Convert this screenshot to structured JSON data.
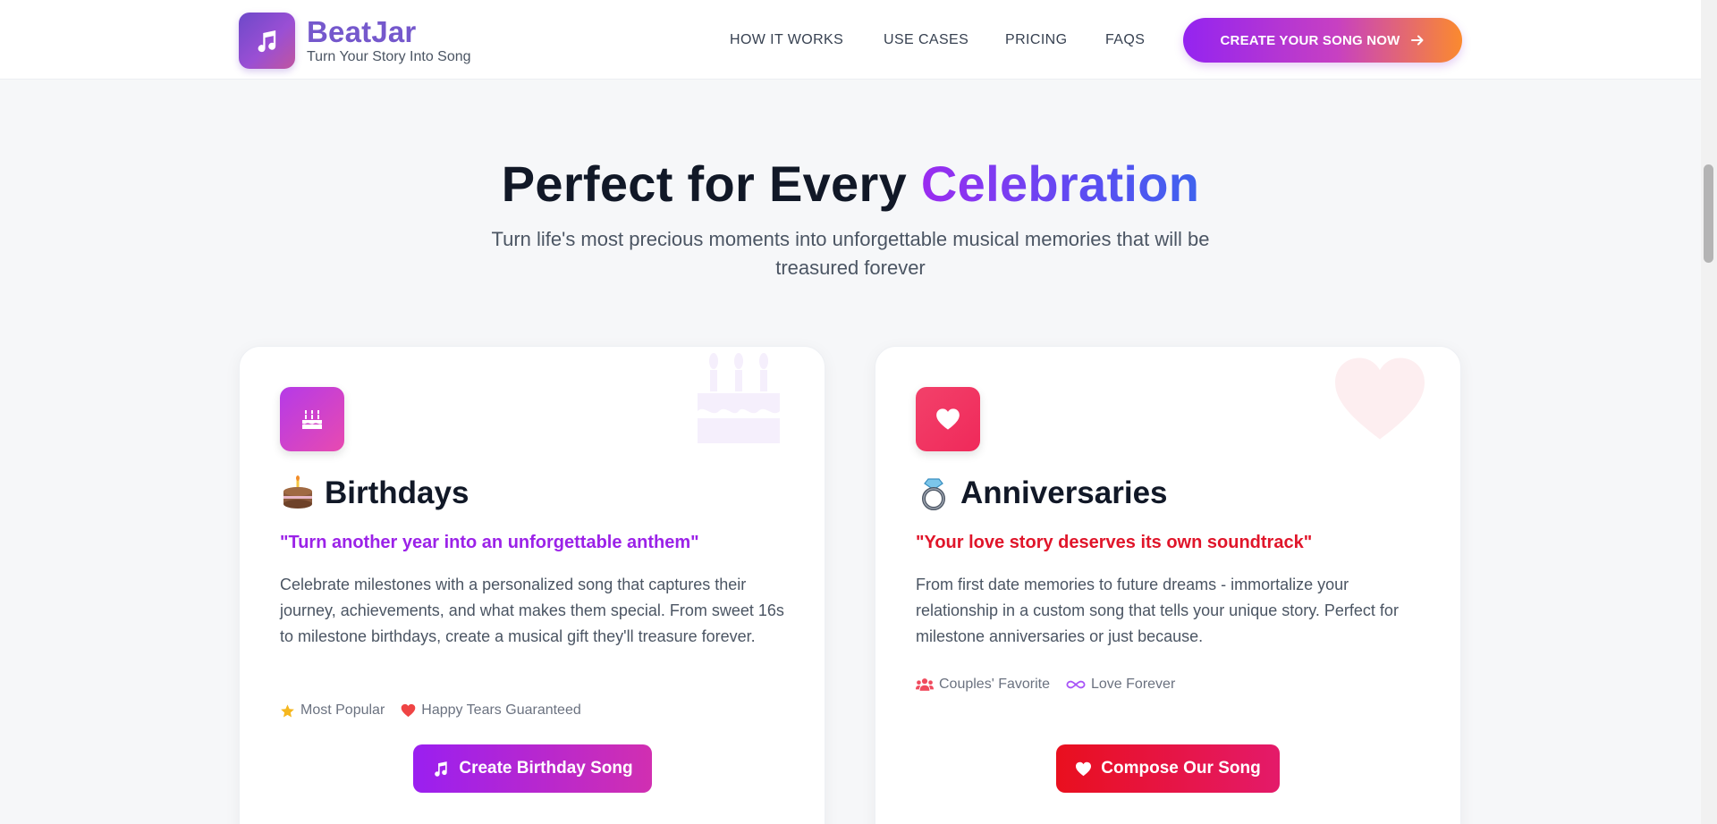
{
  "brand": {
    "name": "BeatJar",
    "tagline": "Turn Your Story Into Song",
    "logo_icon": "music-note-icon"
  },
  "nav": {
    "items": [
      {
        "label": "HOW IT WORKS"
      },
      {
        "label": "USE CASES"
      },
      {
        "label": "PRICING"
      },
      {
        "label": "FAQS"
      }
    ],
    "cta_label": "CREATE YOUR SONG NOW",
    "cta_icon": "arrow-right-icon"
  },
  "section": {
    "title_main": "Perfect for Every ",
    "title_accent": "Celebration",
    "subtitle": "Turn life's most precious moments into unforgettable musical memories that will be treasured forever"
  },
  "cards": [
    {
      "icon": "birthday-cake-icon",
      "emoji_icon": "cake-emoji-icon",
      "title": "Birthdays",
      "quote": "\"Turn another year into an unforgettable anthem\"",
      "description": "Celebrate milestones with a personalized song that captures their journey, achievements, and what makes them special. From sweet 16s to milestone birthdays, create a musical gift they'll treasure forever.",
      "badges": [
        {
          "icon": "star-icon",
          "label": "Most Popular"
        },
        {
          "icon": "heart-icon",
          "label": "Happy Tears Guaranteed"
        }
      ],
      "button_label": "Create Birthday Song",
      "button_icon": "music-note-icon"
    },
    {
      "icon": "heart-icon",
      "emoji_icon": "ring-emoji-icon",
      "title": "Anniversaries",
      "quote": "\"Your love story deserves its own soundtrack\"",
      "description": "From first date memories to future dreams - immortalize your relationship in a custom song that tells your unique story. Perfect for milestone anniversaries or just because.",
      "badges": [
        {
          "icon": "users-icon",
          "label": "Couples' Favorite"
        },
        {
          "icon": "infinity-icon",
          "label": "Love Forever"
        }
      ],
      "button_label": "Compose Our Song",
      "button_icon": "heart-icon"
    }
  ],
  "colors": {
    "brand_purple": "#7558cc",
    "birthday_accent": "#9b22e8",
    "anniversary_accent": "#e0152a",
    "cta_gradient_start": "#9424f0",
    "cta_gradient_end": "#fb8a2e"
  }
}
